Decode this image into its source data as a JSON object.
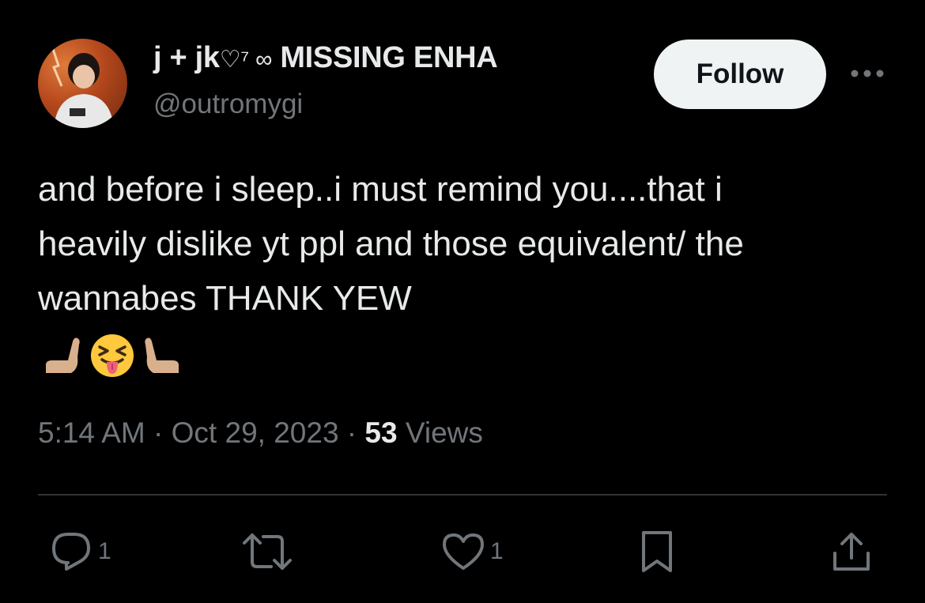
{
  "author": {
    "display_name": "j + jk",
    "display_name_emoji": "♡⁷ ∞",
    "display_name_suffix": "MISSING ENHA",
    "handle": "@outromygi"
  },
  "follow_label": "Follow",
  "tweet": {
    "text": "and before i sleep..i must remind you....that i\nheavily dislike yt ppl and those equivalent/ the\nwannabes THANK YEW",
    "emojis": [
      "🫷🏽",
      "😝",
      "🫸🏽"
    ]
  },
  "meta": {
    "time": "5:14 AM",
    "separator": " · ",
    "date": "Oct 29, 2023",
    "separator2": " · ",
    "views_count": "53",
    "views_label": " Views"
  },
  "actions": {
    "reply_count": "1",
    "like_count": "1"
  },
  "colors": {
    "background": "#000000",
    "primary_text": "#e7e9ea",
    "secondary_text": "#71767b",
    "divider": "#2f3336",
    "follow_bg": "#eff3f4"
  }
}
